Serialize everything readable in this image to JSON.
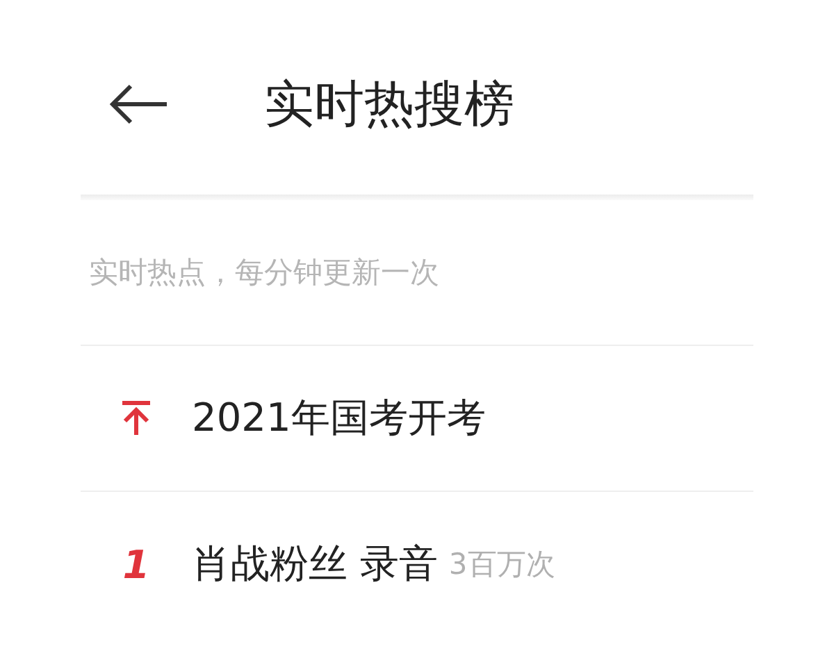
{
  "header": {
    "title": "实时热搜榜"
  },
  "subtitle": "实时热点，每分钟更新一次",
  "items": [
    {
      "kind": "pinned",
      "title": "2021年国考开考"
    },
    {
      "kind": "ranked",
      "rank": "1",
      "title": "肖战粉丝 录音",
      "count": "3百万次"
    }
  ]
}
